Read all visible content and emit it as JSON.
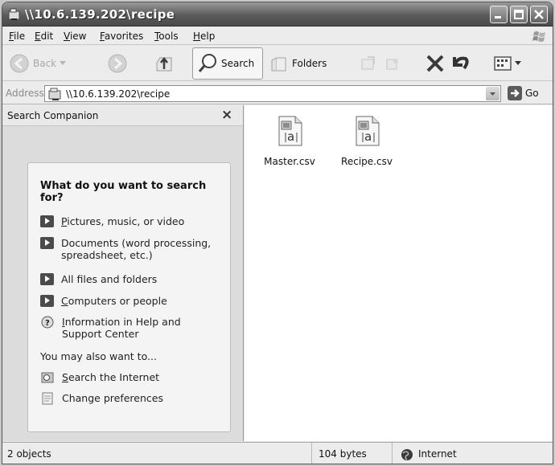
{
  "window": {
    "title": "\\\\10.6.139.202\\recipe"
  },
  "menu": [
    {
      "label": "File"
    },
    {
      "label": "Edit"
    },
    {
      "label": "View"
    },
    {
      "label": "Favorites"
    },
    {
      "label": "Tools"
    },
    {
      "label": "Help"
    }
  ],
  "toolbar": {
    "back_label": "Back",
    "search_label": "Search",
    "folders_label": "Folders"
  },
  "address": {
    "label": "Address",
    "value": "\\\\10.6.139.202\\recipe",
    "go_label": "Go"
  },
  "search_companion": {
    "title": "Search Companion",
    "close_label": "×",
    "heading": "What do you want to search for?",
    "options": [
      {
        "label": "Pictures, music, or video"
      },
      {
        "label": "Documents (word processing, spreadsheet, etc.)"
      },
      {
        "label": "All files and folders"
      },
      {
        "label": "Computers or people"
      },
      {
        "label": "Information in Help and Support Center"
      }
    ],
    "also_heading": "You may also want to...",
    "also_options": [
      {
        "label": "Search the Internet"
      },
      {
        "label": "Change preferences"
      }
    ]
  },
  "files": [
    {
      "name": "Master.csv"
    },
    {
      "name": "Recipe.csv"
    }
  ],
  "status": {
    "objects": "2 objects",
    "size": "104 bytes",
    "zone": "Internet"
  }
}
